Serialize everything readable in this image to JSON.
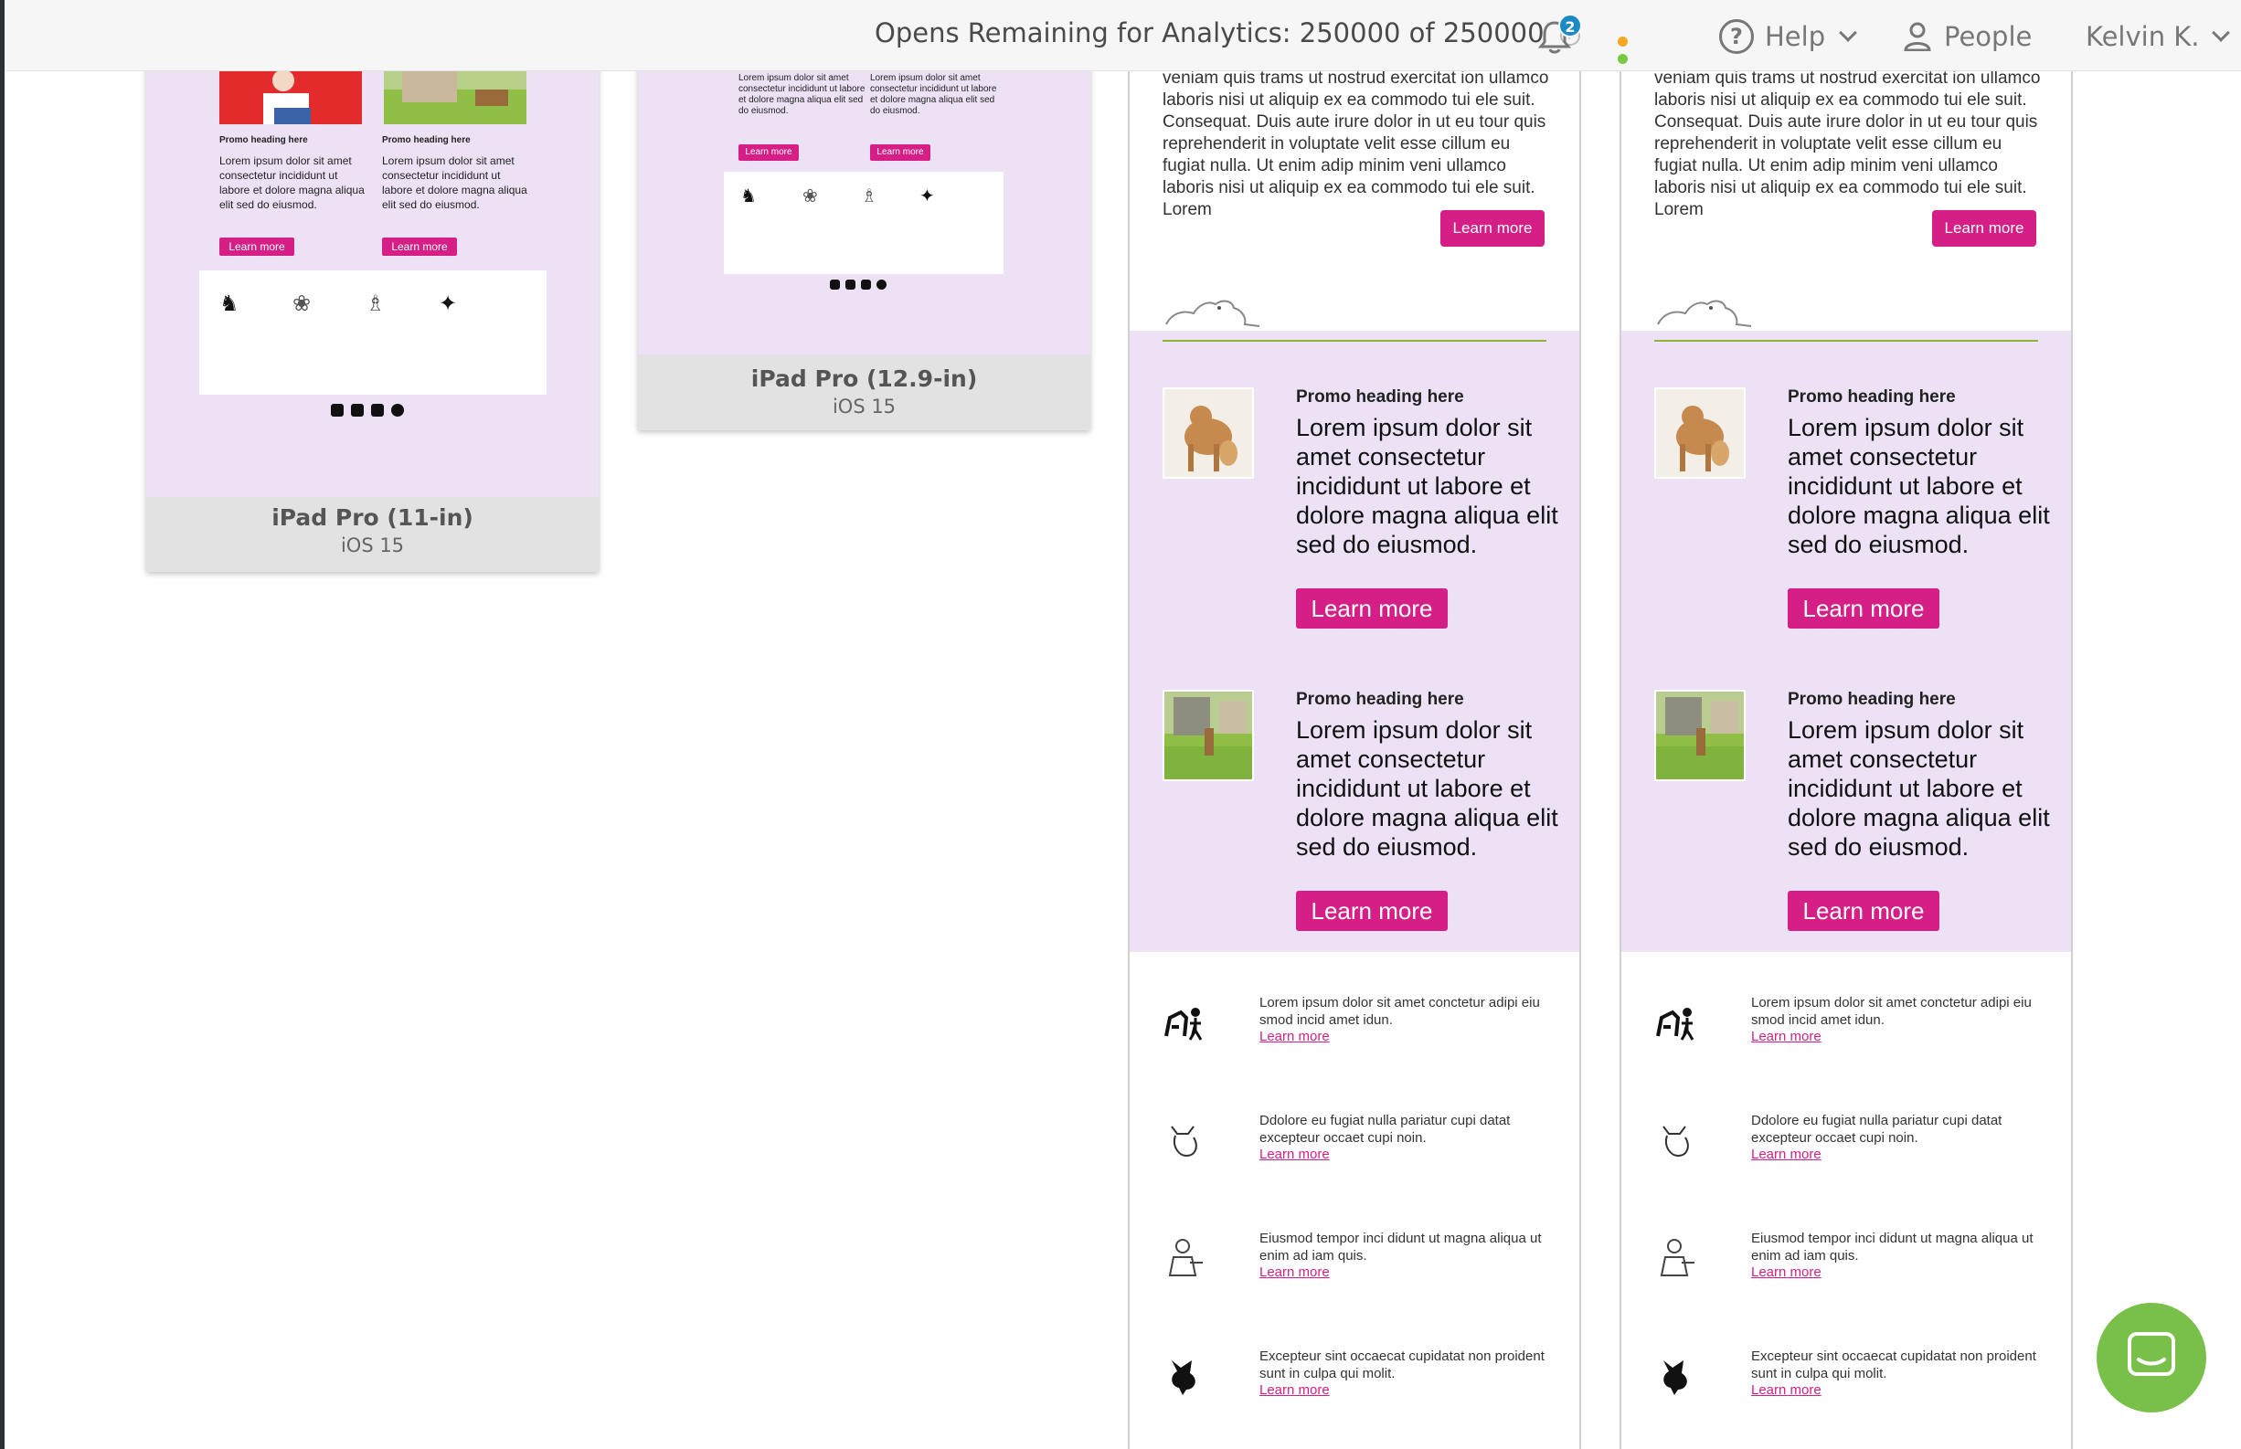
{
  "header": {
    "opens_text": "Opens Remaining for Analytics: 250000 of 250000",
    "notification_count": "2",
    "status_dot_colors": [
      "#f5a623",
      "#7ac943"
    ],
    "help_label": "Help",
    "people_label": "People",
    "user_label": "Kelvin K."
  },
  "devices": [
    {
      "name": "iPad Pro (11-in)",
      "os": "iOS 15"
    },
    {
      "name": "iPad Pro (12.9-in)",
      "os": "iOS 15"
    }
  ],
  "mini": {
    "promo_heading": "Promo heading here",
    "promo_text": "Lorem ipsum dolor sit amet consectetur incididunt ut labore et dolore magna aliqua elit sed do eiusmod.",
    "learn_more": "Learn more"
  },
  "email": {
    "intro_text": "veniam quis trams ut nostrud exercitat ion ullamco laboris nisi ut aliquip ex ea commodo tui ele suit. Consequat. Duis aute irure dolor in ut eu tour quis reprehenderit in voluptate velit esse cillum eu fugiat nulla. Ut enim adip minim veni ullamco laboris nisi ut aliquip ex ea commodo tui ele suit. Lorem",
    "intro_button": "Learn more",
    "promos": [
      {
        "heading": "Promo heading here",
        "text": "Lorem ipsum dolor sit amet consectetur incididunt ut labore et dolore magna aliqua elit sed do eiusmod.",
        "button": "Learn more"
      },
      {
        "heading": "Promo heading here",
        "text": "Lorem ipsum dolor sit amet consectetur incididunt ut labore et dolore magna aliqua elit sed do eiusmod.",
        "button": "Learn more"
      }
    ],
    "features": [
      {
        "text": "Lorem ipsum dolor sit amet conctetur adipi eiu smod incid amet idun.",
        "link": "Learn more"
      },
      {
        "text": "Ddolore eu fugiat nulla pariatur cupi datat excepteur occaet cupi noin.",
        "link": "Learn more"
      },
      {
        "text": "Eiusmod tempor inci didunt ut magna aliqua ut enim ad iam quis.",
        "link": "Learn more"
      },
      {
        "text": "Excepteur sint occaecat cupidatat non proident sunt in culpa qui molit.",
        "link": "Learn more"
      }
    ]
  },
  "colors": {
    "accent_pink": "#d51f86",
    "lavender": "#ece1f5",
    "rule_green": "#8db33a",
    "chat_green": "#78c04a",
    "badge_blue": "#1b8ac4"
  }
}
